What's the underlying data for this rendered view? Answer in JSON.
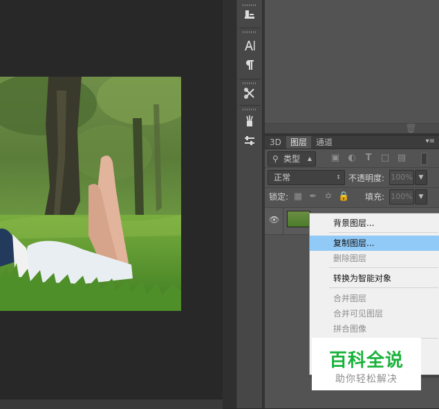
{
  "tool_strip": {
    "icons": [
      "clone-source-icon",
      "character-panel-icon",
      "paragraph-icon",
      "tool-presets-icon",
      "brush-presets-icon",
      "adjustments-icon"
    ]
  },
  "layers_panel": {
    "tabs": [
      {
        "label": "3D",
        "active": false
      },
      {
        "label": "图层",
        "active": true
      },
      {
        "label": "通道",
        "active": false
      }
    ],
    "filter_kind": "类型",
    "blend_mode": "正常",
    "opacity_label": "不透明度:",
    "opacity_value": "100%",
    "lock_label": "锁定:",
    "fill_label": "填充:",
    "fill_value": "100%"
  },
  "context_menu": {
    "items": [
      {
        "label": "背景图层...",
        "state": "normal"
      },
      {
        "label": "复制图层...",
        "state": "selected"
      },
      {
        "label": "删除图层",
        "state": "disabled"
      },
      {
        "label": "转换为智能对象",
        "state": "normal"
      },
      {
        "label": "合并图层",
        "state": "disabled"
      },
      {
        "label": "合并可见图层",
        "state": "disabled"
      },
      {
        "label": "拼合图像",
        "state": "disabled"
      }
    ]
  },
  "watermark": {
    "title": "百科全说",
    "subtitle": "助你轻松解决"
  },
  "colors": {
    "menu_highlight": "#91c9f7",
    "watermark_green": "#19b23b"
  }
}
